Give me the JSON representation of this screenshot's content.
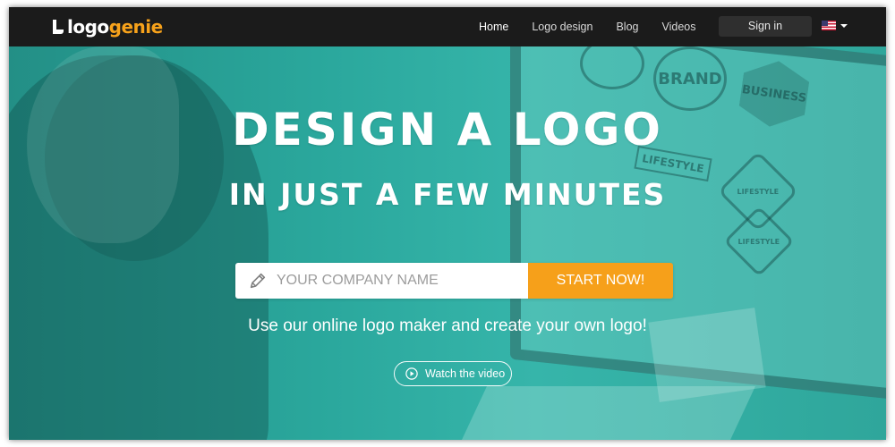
{
  "brand": {
    "logo_part_a": "logo",
    "logo_part_b": "genie",
    "accent_color": "#f7a21b"
  },
  "nav": {
    "items": [
      {
        "label": "Home",
        "active": true
      },
      {
        "label": "Logo design",
        "active": false
      },
      {
        "label": "Blog",
        "active": false
      },
      {
        "label": "Videos",
        "active": false
      }
    ],
    "signin_label": "Sign in",
    "language_icon": "us-flag-icon"
  },
  "hero": {
    "headline_line1": "DESIGN A LOGO",
    "headline_line2": "IN JUST A FEW MINUTES",
    "input_placeholder": "YOUR COMPANY NAME",
    "input_value": "",
    "cta_label": "START NOW!",
    "subtitle": "Use our online logo maker and create your own logo!",
    "video_label": "Watch the video",
    "overlay_color": "#2cab9f",
    "cta_color": "#f6a01a"
  },
  "background_badges": {
    "brand": "BRAND",
    "business": "BUSINESS",
    "lifestyle_ribbon": "LIFESTYLE",
    "lifestyle_a": "LIFESTYLE",
    "lifestyle_b": "LIFESTYLE"
  }
}
